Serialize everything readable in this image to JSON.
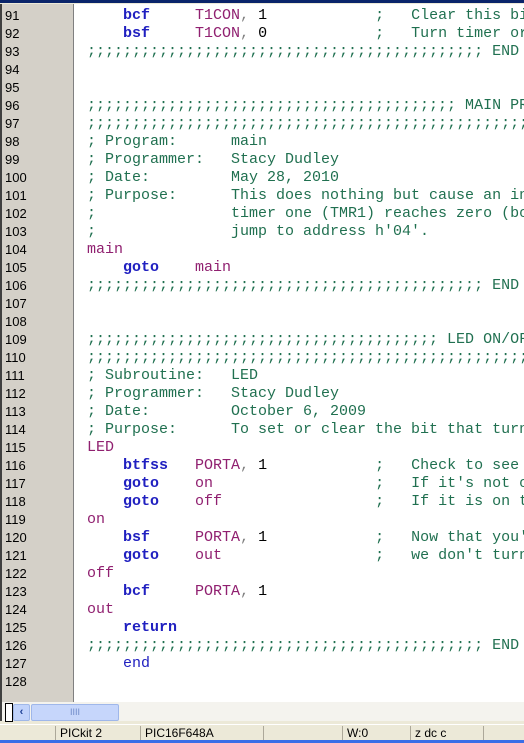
{
  "editor": {
    "colors": {
      "keyword": "#2020c0",
      "operand": "#902070",
      "comment": "#207050",
      "number": "#000000",
      "gutter": "#d4d0c8"
    },
    "lines": [
      {
        "num": "91",
        "segs": [
          [
            "s",
            "    "
          ],
          [
            "k",
            "bcf"
          ],
          [
            "s",
            "     "
          ],
          [
            "o",
            "T1CON"
          ],
          [
            "p",
            ", "
          ],
          [
            "n",
            "1"
          ],
          [
            "s",
            "            "
          ],
          [
            "c",
            ";   Clear this bi"
          ]
        ]
      },
      {
        "num": "92",
        "segs": [
          [
            "s",
            "    "
          ],
          [
            "k",
            "bsf"
          ],
          [
            "s",
            "     "
          ],
          [
            "o",
            "T1CON"
          ],
          [
            "p",
            ", "
          ],
          [
            "n",
            "0"
          ],
          [
            "s",
            "            "
          ],
          [
            "c",
            ";   Turn timer or"
          ]
        ]
      },
      {
        "num": "93",
        "segs": [
          [
            "c",
            ";;;;;;;;;;;;;;;;;;;;;;;;;;;;;;;;;;;;;;;;;;;; END"
          ]
        ]
      },
      {
        "num": "94",
        "segs": []
      },
      {
        "num": "95",
        "segs": []
      },
      {
        "num": "96",
        "segs": [
          [
            "c",
            ";;;;;;;;;;;;;;;;;;;;;;;;;;;;;;;;;;;;;;;;; MAIN PR"
          ]
        ]
      },
      {
        "num": "97",
        "segs": [
          [
            "c",
            ";;;;;;;;;;;;;;;;;;;;;;;;;;;;;;;;;;;;;;;;;;;;;;;;;"
          ]
        ]
      },
      {
        "num": "98",
        "segs": [
          [
            "c",
            "; Program:      main"
          ]
        ]
      },
      {
        "num": "99",
        "segs": [
          [
            "c",
            "; Programmer:   Stacy Dudley"
          ]
        ]
      },
      {
        "num": "100",
        "segs": [
          [
            "c",
            "; Date:         May 28, 2010"
          ]
        ]
      },
      {
        "num": "101",
        "segs": [
          [
            "c",
            "; Purpose:      This does nothing but cause an in"
          ]
        ]
      },
      {
        "num": "102",
        "segs": [
          [
            "c",
            ";               timer one (TMR1) reaches zero (bo"
          ]
        ]
      },
      {
        "num": "103",
        "segs": [
          [
            "c",
            ";               jump to address h'04'."
          ]
        ]
      },
      {
        "num": "104",
        "segs": [
          [
            "l",
            "main"
          ]
        ]
      },
      {
        "num": "105",
        "segs": [
          [
            "s",
            "    "
          ],
          [
            "k",
            "goto"
          ],
          [
            "s",
            "    "
          ],
          [
            "o",
            "main"
          ]
        ]
      },
      {
        "num": "106",
        "segs": [
          [
            "c",
            ";;;;;;;;;;;;;;;;;;;;;;;;;;;;;;;;;;;;;;;;;;;; END"
          ]
        ]
      },
      {
        "num": "107",
        "segs": []
      },
      {
        "num": "108",
        "segs": []
      },
      {
        "num": "109",
        "segs": [
          [
            "c",
            ";;;;;;;;;;;;;;;;;;;;;;;;;;;;;;;;;;;;;;; LED ON/OF"
          ]
        ]
      },
      {
        "num": "110",
        "segs": [
          [
            "c",
            ";;;;;;;;;;;;;;;;;;;;;;;;;;;;;;;;;;;;;;;;;;;;;;;;;"
          ]
        ]
      },
      {
        "num": "111",
        "segs": [
          [
            "c",
            "; Subroutine:   LED"
          ]
        ]
      },
      {
        "num": "112",
        "segs": [
          [
            "c",
            "; Programmer:   Stacy Dudley"
          ]
        ]
      },
      {
        "num": "113",
        "segs": [
          [
            "c",
            "; Date:         October 6, 2009"
          ]
        ]
      },
      {
        "num": "114",
        "segs": [
          [
            "c",
            "; Purpose:      To set or clear the bit that turn"
          ]
        ]
      },
      {
        "num": "115",
        "segs": [
          [
            "l",
            "LED"
          ]
        ]
      },
      {
        "num": "116",
        "segs": [
          [
            "s",
            "    "
          ],
          [
            "k",
            "btfss"
          ],
          [
            "s",
            "   "
          ],
          [
            "o",
            "PORTA"
          ],
          [
            "p",
            ", "
          ],
          [
            "n",
            "1"
          ],
          [
            "s",
            "            "
          ],
          [
            "c",
            ";   Check to see"
          ]
        ]
      },
      {
        "num": "117",
        "segs": [
          [
            "s",
            "    "
          ],
          [
            "k",
            "goto"
          ],
          [
            "s",
            "    "
          ],
          [
            "o",
            "on"
          ],
          [
            "s",
            "                  "
          ],
          [
            "c",
            ";   If it's not o"
          ]
        ]
      },
      {
        "num": "118",
        "segs": [
          [
            "s",
            "    "
          ],
          [
            "k",
            "goto"
          ],
          [
            "s",
            "    "
          ],
          [
            "o",
            "off"
          ],
          [
            "s",
            "                 "
          ],
          [
            "c",
            ";   If it is on t"
          ]
        ]
      },
      {
        "num": "119",
        "segs": [
          [
            "l",
            "on"
          ]
        ]
      },
      {
        "num": "120",
        "segs": [
          [
            "s",
            "    "
          ],
          [
            "k",
            "bsf"
          ],
          [
            "s",
            "     "
          ],
          [
            "o",
            "PORTA"
          ],
          [
            "p",
            ", "
          ],
          [
            "n",
            "1"
          ],
          [
            "s",
            "            "
          ],
          [
            "c",
            ";   Now that you'"
          ]
        ]
      },
      {
        "num": "121",
        "segs": [
          [
            "s",
            "    "
          ],
          [
            "k",
            "goto"
          ],
          [
            "s",
            "    "
          ],
          [
            "o",
            "out"
          ],
          [
            "s",
            "                 "
          ],
          [
            "c",
            ";   we don't turn"
          ]
        ]
      },
      {
        "num": "122",
        "segs": [
          [
            "l",
            "off"
          ]
        ]
      },
      {
        "num": "123",
        "segs": [
          [
            "s",
            "    "
          ],
          [
            "k",
            "bcf"
          ],
          [
            "s",
            "     "
          ],
          [
            "o",
            "PORTA"
          ],
          [
            "p",
            ", "
          ],
          [
            "n",
            "1"
          ]
        ]
      },
      {
        "num": "124",
        "segs": [
          [
            "l",
            "out"
          ]
        ]
      },
      {
        "num": "125",
        "segs": [
          [
            "s",
            "    "
          ],
          [
            "k",
            "return"
          ]
        ]
      },
      {
        "num": "126",
        "segs": [
          [
            "c",
            ";;;;;;;;;;;;;;;;;;;;;;;;;;;;;;;;;;;;;;;;;;;; END"
          ]
        ]
      },
      {
        "num": "127",
        "segs": [
          [
            "s",
            "    "
          ],
          [
            "k2",
            "end"
          ]
        ]
      },
      {
        "num": "128",
        "segs": []
      }
    ]
  },
  "scrollbar": {
    "left_arrow": "‹",
    "thumb_grip": "IIII"
  },
  "statusbar": {
    "programmer": "PICkit 2",
    "device": "PIC16F648A",
    "empty": "",
    "w_register": "W:0",
    "flags": "z dc c"
  }
}
